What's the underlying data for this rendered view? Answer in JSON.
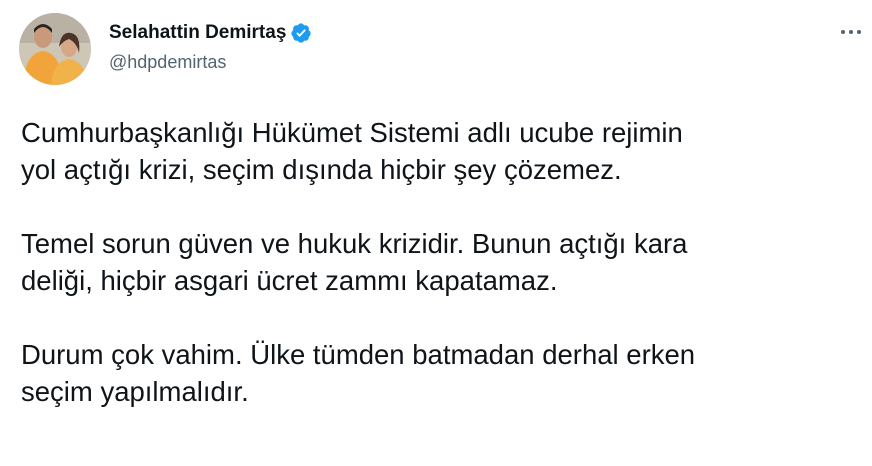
{
  "author": {
    "display_name": "Selahattin Demirtaş",
    "handle": "@hdpdemirtas",
    "verified": true
  },
  "icons": {
    "verified": "verified-badge-icon",
    "more": "more-options-icon"
  },
  "colors": {
    "verified_blue": "#1d9bf0",
    "text_primary": "#0f1419",
    "text_secondary": "#536471"
  },
  "tweet": {
    "paragraphs": [
      "Cumhurbaşkanlığı Hükümet Sistemi adlı ucube rejimin\nyol açtığı krizi, seçim dışında hiçbir şey çözemez.",
      "Temel sorun güven ve hukuk krizidir. Bunun açtığı kara\ndeliği, hiçbir asgari ücret zammı kapatamaz.",
      "Durum çok vahim. Ülke tümden batmadan derhal erken\nseçim yapılmalıdır."
    ]
  }
}
